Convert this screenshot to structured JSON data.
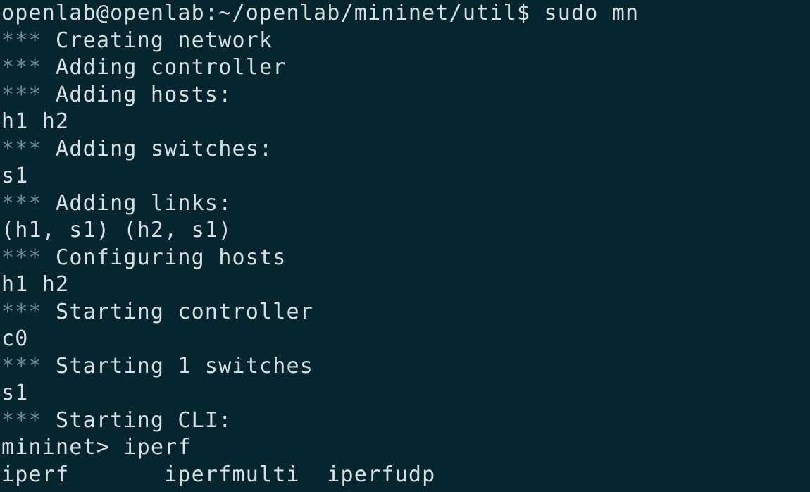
{
  "terminal": {
    "lines": [
      {
        "kind": "prompt",
        "text": "openlab@openlab:~/openlab/mininet/util$ sudo mn"
      },
      {
        "kind": "info",
        "stars": "***",
        "text": " Creating network"
      },
      {
        "kind": "info",
        "stars": "***",
        "text": " Adding controller"
      },
      {
        "kind": "info",
        "stars": "***",
        "text": " Adding hosts:"
      },
      {
        "kind": "plain",
        "text": "h1 h2"
      },
      {
        "kind": "info",
        "stars": "***",
        "text": " Adding switches:"
      },
      {
        "kind": "plain",
        "text": "s1"
      },
      {
        "kind": "info",
        "stars": "***",
        "text": " Adding links:"
      },
      {
        "kind": "plain",
        "text": "(h1, s1) (h2, s1)"
      },
      {
        "kind": "info",
        "stars": "***",
        "text": " Configuring hosts"
      },
      {
        "kind": "plain",
        "text": "h1 h2"
      },
      {
        "kind": "info",
        "stars": "***",
        "text": " Starting controller"
      },
      {
        "kind": "plain",
        "text": "c0"
      },
      {
        "kind": "info",
        "stars": "***",
        "text": " Starting 1 switches"
      },
      {
        "kind": "plain",
        "text": "s1"
      },
      {
        "kind": "info",
        "stars": "***",
        "text": " Starting CLI:"
      },
      {
        "kind": "plain",
        "text": "mininet> iperf"
      },
      {
        "kind": "plain",
        "text": "iperf       iperfmulti  iperfudp"
      }
    ]
  },
  "colors": {
    "background": "#05262f",
    "text": "#d6dfe2",
    "stars": "#6f8d94"
  }
}
